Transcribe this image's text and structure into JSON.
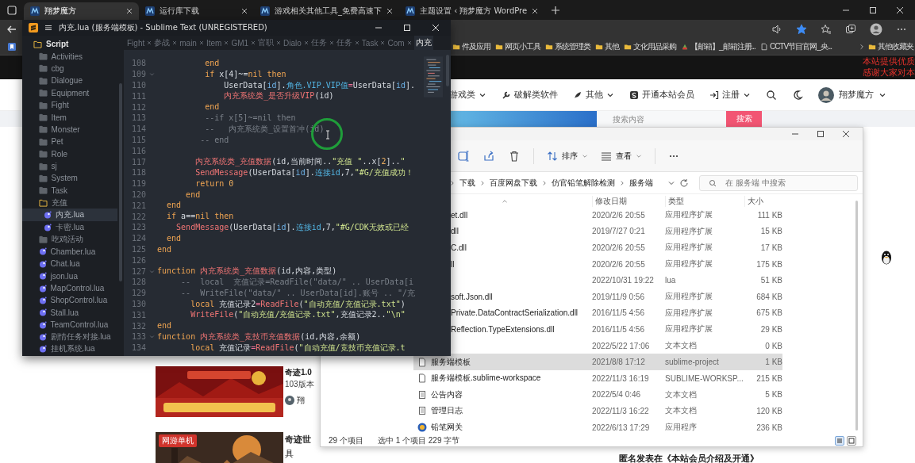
{
  "browser": {
    "tabs": [
      {
        "title": "翔梦魔方",
        "selected": true
      },
      {
        "title": "运行库下载",
        "selected": false
      },
      {
        "title": "游戏相关其他工具_免费高速下",
        "selected": false
      },
      {
        "title": "主题设置 ‹ 翔梦魔方 WordPre",
        "selected": false
      }
    ],
    "starred": true,
    "bookmarks": [
      {
        "label": "件及应用",
        "kind": "folder"
      },
      {
        "label": "网页小工具",
        "kind": "folder"
      },
      {
        "label": "系统管理类",
        "kind": "folder"
      },
      {
        "label": "其他",
        "kind": "folder"
      },
      {
        "label": "文化用品采购",
        "kind": "folder"
      },
      {
        "label": "【邮箱】_邮箱注册...",
        "kind": "site"
      },
      {
        "label": "CCTV节目官网_央...",
        "kind": "page"
      }
    ],
    "other_bookmarks": "其他收藏夹"
  },
  "site": {
    "notice": [
      "本站提供优质",
      "感谢大家对本"
    ],
    "nav": [
      {
        "label": "游戏类",
        "dropdown": true
      },
      {
        "label": "破解类软件",
        "dropdown": false
      },
      {
        "label": "其他",
        "dropdown": true
      },
      {
        "label": "开通本站会员",
        "dropdown": false
      },
      {
        "label": "注册",
        "dropdown": true
      }
    ],
    "user": "翔梦魔方",
    "search": {
      "placeholder": "搜索内容",
      "button": "搜索"
    },
    "posts": [
      {
        "title": "奇迹1.0",
        "subtitle": "103版本",
        "author": "翔"
      },
      {
        "badge": "网游单机",
        "title": "奇迹世",
        "subtitle": "具"
      }
    ],
    "comment": "匿名发表在《本站会员介绍及开通》"
  },
  "sublime": {
    "title": "内充.lua (服务端模板) - Sublime Text (UNREGISTERED)",
    "tree": [
      {
        "label": "Script",
        "kind": "folder",
        "expanded": true,
        "selected": false,
        "children": [
          {
            "label": "Activities",
            "kind": "folder",
            "expanded": false,
            "selected": false
          },
          {
            "label": "cbg",
            "kind": "folder",
            "expanded": false,
            "selected": false
          },
          {
            "label": "Dialogue",
            "kind": "folder",
            "expanded": false,
            "selected": false
          },
          {
            "label": "Equipment",
            "kind": "folder",
            "expanded": false,
            "selected": false
          },
          {
            "label": "Fight",
            "kind": "folder",
            "expanded": false,
            "selected": false
          },
          {
            "label": "Item",
            "kind": "folder",
            "expanded": false,
            "selected": false
          },
          {
            "label": "Monster",
            "kind": "folder",
            "expanded": false,
            "selected": false
          },
          {
            "label": "Pet",
            "kind": "folder",
            "expanded": false,
            "selected": false
          },
          {
            "label": "Role",
            "kind": "folder",
            "expanded": false,
            "selected": false
          },
          {
            "label": "sj",
            "kind": "folder",
            "expanded": false,
            "selected": false
          },
          {
            "label": "System",
            "kind": "folder",
            "expanded": false,
            "selected": false
          },
          {
            "label": "Task",
            "kind": "folder",
            "expanded": false,
            "selected": false
          },
          {
            "label": "充值",
            "kind": "folder",
            "expanded": true,
            "selected": false,
            "children": [
              {
                "label": "内充.lua",
                "kind": "file",
                "selected": true
              },
              {
                "label": "卡密.lua",
                "kind": "file",
                "selected": false
              }
            ]
          },
          {
            "label": "吃鸡活动",
            "kind": "folder",
            "expanded": false,
            "selected": false
          },
          {
            "label": "Chamber.lua",
            "kind": "file",
            "selected": false
          },
          {
            "label": "Chat.lua",
            "kind": "file",
            "selected": false
          },
          {
            "label": "json.lua",
            "kind": "file",
            "selected": false
          },
          {
            "label": "MapControl.lua",
            "kind": "file",
            "selected": false
          },
          {
            "label": "ShopControl.lua",
            "kind": "file",
            "selected": false
          },
          {
            "label": "Stall.lua",
            "kind": "file",
            "selected": false
          },
          {
            "label": "TeamControl.lua",
            "kind": "file",
            "selected": false
          },
          {
            "label": "剧情任务对接.lua",
            "kind": "file",
            "selected": false
          },
          {
            "label": "挂机系统.lua",
            "kind": "file",
            "selected": false
          }
        ]
      }
    ],
    "tabs": [
      {
        "label": "Fight",
        "selected": false
      },
      {
        "label": "参战",
        "selected": false
      },
      {
        "label": "main",
        "selected": false
      },
      {
        "label": "Item",
        "selected": false
      },
      {
        "label": "GM1",
        "selected": false
      },
      {
        "label": "官职",
        "selected": false
      },
      {
        "label": "Dialo",
        "selected": false
      },
      {
        "label": "任务",
        "selected": false
      },
      {
        "label": "任务",
        "selected": false
      },
      {
        "label": "Task",
        "selected": false
      },
      {
        "label": "Com",
        "selected": false
      },
      {
        "label": "内充",
        "selected": true
      }
    ],
    "lines": [
      {
        "number": "108",
        "fold": false,
        "tokens": [
          {
            "text": "          end",
            "kind": "kw"
          }
        ]
      },
      {
        "number": "109",
        "fold": true,
        "tokens": [
          {
            "text": "          if ",
            "kind": "kw"
          },
          {
            "text": "x[4]~=",
            "kind": "plain"
          },
          {
            "text": "nil then",
            "kind": "kw"
          }
        ]
      },
      {
        "number": "110",
        "fold": false,
        "tokens": [
          {
            "text": "              UserData[",
            "kind": "plain"
          },
          {
            "text": "id",
            "kind": "var"
          },
          {
            "text": "].",
            "kind": "plain"
          },
          {
            "text": "角色.VIP.VIP值",
            "kind": "prop"
          },
          {
            "text": "=",
            "kind": "op"
          },
          {
            "text": "UserData[",
            "kind": "plain"
          },
          {
            "text": "id",
            "kind": "var"
          },
          {
            "text": "].",
            "kind": "plain"
          }
        ]
      },
      {
        "number": "111",
        "fold": false,
        "tokens": [
          {
            "text": "              内充系统类_是否升级VIP",
            "kind": "fn"
          },
          {
            "text": "(id)",
            "kind": "plain"
          }
        ]
      },
      {
        "number": "112",
        "fold": false,
        "tokens": [
          {
            "text": "          end",
            "kind": "kw"
          }
        ]
      },
      {
        "number": "113",
        "fold": false,
        "tokens": [
          {
            "text": "          --if x[5]~=nil then",
            "kind": "cmt"
          }
        ]
      },
      {
        "number": "114",
        "fold": false,
        "tokens": [
          {
            "text": "          --   内充系统类_设置首冲(id)",
            "kind": "cmt"
          }
        ]
      },
      {
        "number": "115",
        "fold": false,
        "tokens": [
          {
            "text": "         -- end",
            "kind": "cmt"
          }
        ]
      },
      {
        "number": "116",
        "fold": false
      },
      {
        "number": "117",
        "fold": false,
        "tokens": [
          {
            "text": "        内充系统类_充值数据",
            "kind": "fn"
          },
          {
            "text": "(id,当前时间..",
            "kind": "plain"
          },
          {
            "text": "\"充值 \"",
            "kind": "str"
          },
          {
            "text": "..x[",
            "kind": "plain"
          },
          {
            "text": "2",
            "kind": "num"
          },
          {
            "text": "]..",
            "kind": "plain"
          },
          {
            "text": "\"",
            "kind": "str"
          }
        ]
      },
      {
        "number": "118",
        "fold": false,
        "tokens": [
          {
            "text": "        SendMessage",
            "kind": "fn"
          },
          {
            "text": "(UserData[",
            "kind": "plain"
          },
          {
            "text": "id",
            "kind": "var"
          },
          {
            "text": "].",
            "kind": "plain"
          },
          {
            "text": "连接id",
            "kind": "prop"
          },
          {
            "text": ",7,",
            "kind": "plain"
          },
          {
            "text": "\"#G/充值成功！",
            "kind": "str"
          }
        ]
      },
      {
        "number": "119",
        "fold": false,
        "tokens": [
          {
            "text": "        return ",
            "kind": "kw"
          },
          {
            "text": "0",
            "kind": "num"
          }
        ]
      },
      {
        "number": "120",
        "fold": false,
        "tokens": [
          {
            "text": "      end",
            "kind": "kw"
          }
        ]
      },
      {
        "number": "121",
        "fold": false,
        "tokens": [
          {
            "text": "  end",
            "kind": "kw"
          }
        ]
      },
      {
        "number": "122",
        "fold": false,
        "tokens": [
          {
            "text": "  if ",
            "kind": "kw"
          },
          {
            "text": "a==",
            "kind": "plain"
          },
          {
            "text": "nil then",
            "kind": "kw"
          }
        ]
      },
      {
        "number": "123",
        "fold": false,
        "tokens": [
          {
            "text": "    SendMessage",
            "kind": "fn"
          },
          {
            "text": "(UserData[",
            "kind": "plain"
          },
          {
            "text": "id",
            "kind": "var"
          },
          {
            "text": "].",
            "kind": "plain"
          },
          {
            "text": "连接id",
            "kind": "prop"
          },
          {
            "text": ",7,",
            "kind": "plain"
          },
          {
            "text": "\"#G/CDK无效或已经",
            "kind": "str"
          }
        ]
      },
      {
        "number": "124",
        "fold": false,
        "tokens": [
          {
            "text": "  end",
            "kind": "kw"
          }
        ]
      },
      {
        "number": "125",
        "fold": false,
        "tokens": [
          {
            "text": "end",
            "kind": "kw"
          }
        ]
      },
      {
        "number": "126",
        "fold": false
      },
      {
        "number": "127",
        "fold": true,
        "tokens": [
          {
            "text": "function ",
            "kind": "kw"
          },
          {
            "text": "内充系统类_充值数据",
            "kind": "fn"
          },
          {
            "text": "(id,内容,类型)",
            "kind": "plain"
          }
        ]
      },
      {
        "number": "128",
        "fold": false,
        "tokens": [
          {
            "text": "     --  local  充值记录=ReadFile(\"data/\" .. UserData[i",
            "kind": "cmt"
          }
        ]
      },
      {
        "number": "129",
        "fold": false,
        "tokens": [
          {
            "text": "     --  WriteFile(\"data/\" .. UserData[id].账号 .. \"/充",
            "kind": "cmt"
          }
        ]
      },
      {
        "number": "130",
        "fold": false,
        "tokens": [
          {
            "text": "       local ",
            "kind": "kw"
          },
          {
            "text": "充值记录2",
            "kind": "plain"
          },
          {
            "text": "=",
            "kind": "op"
          },
          {
            "text": "ReadFile",
            "kind": "fn"
          },
          {
            "text": "(",
            "kind": "plain"
          },
          {
            "text": "\"自动充值/充值记录.txt\"",
            "kind": "str"
          },
          {
            "text": ")",
            "kind": "plain"
          }
        ]
      },
      {
        "number": "131",
        "fold": false,
        "tokens": [
          {
            "text": "       WriteFile",
            "kind": "fn"
          },
          {
            "text": "(",
            "kind": "plain"
          },
          {
            "text": "\"自动充值/充值记录.txt\"",
            "kind": "str"
          },
          {
            "text": ",充值记录2..",
            "kind": "plain"
          },
          {
            "text": "\"\\n\"",
            "kind": "str"
          }
        ]
      },
      {
        "number": "132",
        "fold": false,
        "tokens": [
          {
            "text": "end",
            "kind": "kw"
          }
        ]
      },
      {
        "number": "133",
        "fold": true,
        "tokens": [
          {
            "text": "function ",
            "kind": "kw"
          },
          {
            "text": "内充系统类_竞技币充值数据",
            "kind": "fn"
          },
          {
            "text": "(id,内容,余额)",
            "kind": "plain"
          }
        ]
      },
      {
        "number": "134",
        "fold": false,
        "tokens": [
          {
            "text": "       local ",
            "kind": "kw"
          },
          {
            "text": "充值记录",
            "kind": "plain"
          },
          {
            "text": "=",
            "kind": "op"
          },
          {
            "text": "ReadFile",
            "kind": "fn"
          },
          {
            "text": "(",
            "kind": "plain"
          },
          {
            "text": "\"自动充值/竞技币充值记录.t",
            "kind": "str"
          }
        ]
      }
    ]
  },
  "explorer": {
    "toolbar": {
      "sort": "排序",
      "view": "查看"
    },
    "breadcrumb": [
      "下载",
      "百度网盘下载",
      "仿官铅笔解除检测",
      "服务端"
    ],
    "search": {
      "placeholder": "在 服务端 中搜索"
    },
    "columns": [
      "修改日期",
      "类型",
      "大小"
    ],
    "rows": [
      {
        "name": "et.dll",
        "date": "2020/2/6 20:55",
        "type": "应用程序扩展",
        "size": "111 KB",
        "kind": "covered",
        "selected": false
      },
      {
        "name": "dll",
        "date": "2019/7/27 0:21",
        "type": "应用程序扩展",
        "size": "15 KB",
        "kind": "covered",
        "selected": false
      },
      {
        "name": "C.dll",
        "date": "2020/2/6 20:55",
        "type": "应用程序扩展",
        "size": "17 KB",
        "kind": "covered",
        "selected": false
      },
      {
        "name": "ll",
        "date": "2020/2/6 20:55",
        "type": "应用程序扩展",
        "size": "175 KB",
        "kind": "covered",
        "selected": false
      },
      {
        "date": "2022/10/31 19:22",
        "type": "lua",
        "size": "51 KB",
        "kind": "covered",
        "selected": false
      },
      {
        "name": "soft.Json.dll",
        "date": "2019/11/9 0:56",
        "type": "应用程序扩展",
        "size": "684 KB",
        "kind": "covered",
        "selected": false
      },
      {
        "name": "Private.DataContractSerialization.dll",
        "date": "2016/11/5 4:56",
        "type": "应用程序扩展",
        "size": "675 KB",
        "kind": "covered",
        "selected": false
      },
      {
        "name": "Reflection.TypeExtensions.dll",
        "date": "2016/11/5 4:56",
        "type": "应用程序扩展",
        "size": "29 KB",
        "kind": "covered",
        "selected": false
      },
      {
        "date": "2022/5/22 17:06",
        "type": "文本文档",
        "size": "0 KB",
        "kind": "covered",
        "selected": false
      },
      {
        "name": "服务端模板",
        "date": "2021/8/8 17:12",
        "type": "sublime-project",
        "size": "1 KB",
        "kind": "document",
        "selected": true
      },
      {
        "name": "服务端模板.sublime-workspace",
        "date": "2022/11/3 16:19",
        "type": "SUBLIME-WORKSP...",
        "size": "215 KB",
        "kind": "document",
        "selected": false
      },
      {
        "name": "公告内容",
        "date": "2022/5/4 0:46",
        "type": "文本文档",
        "size": "5 KB",
        "kind": "text",
        "selected": false
      },
      {
        "name": "管理日志",
        "date": "2022/11/3 16:22",
        "type": "文本文档",
        "size": "120 KB",
        "kind": "text",
        "selected": false
      },
      {
        "name": "铅笔网关",
        "date": "2022/6/13 17:29",
        "type": "应用程序",
        "size": "236 KB",
        "kind": "program",
        "selected": false
      }
    ],
    "status": {
      "count": "29 个项目",
      "selection": "选中 1 个项目 229 字节"
    },
    "views": [
      {
        "selected": true
      },
      {
        "selected": false
      }
    ]
  }
}
